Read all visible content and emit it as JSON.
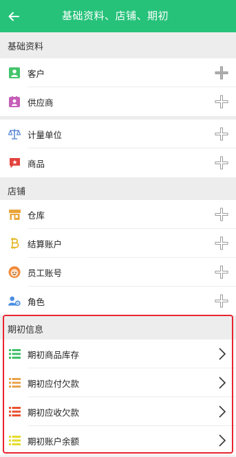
{
  "header": {
    "title": "基础资料、店铺、期初"
  },
  "sections": [
    {
      "title": "基础资料"
    },
    {
      "title": "店铺"
    },
    {
      "title": "期初信息"
    }
  ],
  "rows": [
    {
      "label": "客户",
      "icon": "person-card-icon",
      "color": "#43c46a",
      "action": "add"
    },
    {
      "label": "供应商",
      "icon": "contact-card-icon",
      "color": "#c65fb8",
      "action": "add"
    },
    {
      "label": "计量单位",
      "icon": "balance-scale-icon",
      "color": "#5a8ad6",
      "action": "add"
    },
    {
      "label": "商品",
      "icon": "product-tag-icon",
      "color": "#e2423d",
      "action": "add"
    },
    {
      "label": "仓库",
      "icon": "warehouse-icon",
      "color": "#e9a53a",
      "action": "add"
    },
    {
      "label": "结算账户",
      "icon": "bitcoin-icon",
      "color": "#e3b824",
      "action": "add"
    },
    {
      "label": "员工账号",
      "icon": "employee-face-icon",
      "color": "#f08a3a",
      "action": "add"
    },
    {
      "label": "角色",
      "icon": "role-settings-icon",
      "color": "#4c8ee3",
      "action": "add"
    },
    {
      "label": "期初商品库存",
      "icon": "list-icon",
      "color": "#3fbf68",
      "action": "open"
    },
    {
      "label": "期初应付欠款",
      "icon": "list-icon",
      "color": "#e8a24a",
      "action": "open"
    },
    {
      "label": "期初应收欠款",
      "icon": "list-icon",
      "color": "#e8512f",
      "action": "open"
    },
    {
      "label": "期初账户余额",
      "icon": "list-icon",
      "color": "#e4dd2a",
      "action": "open"
    }
  ],
  "colors": {
    "header": "#26c27a",
    "highlight": "#e8242e"
  }
}
